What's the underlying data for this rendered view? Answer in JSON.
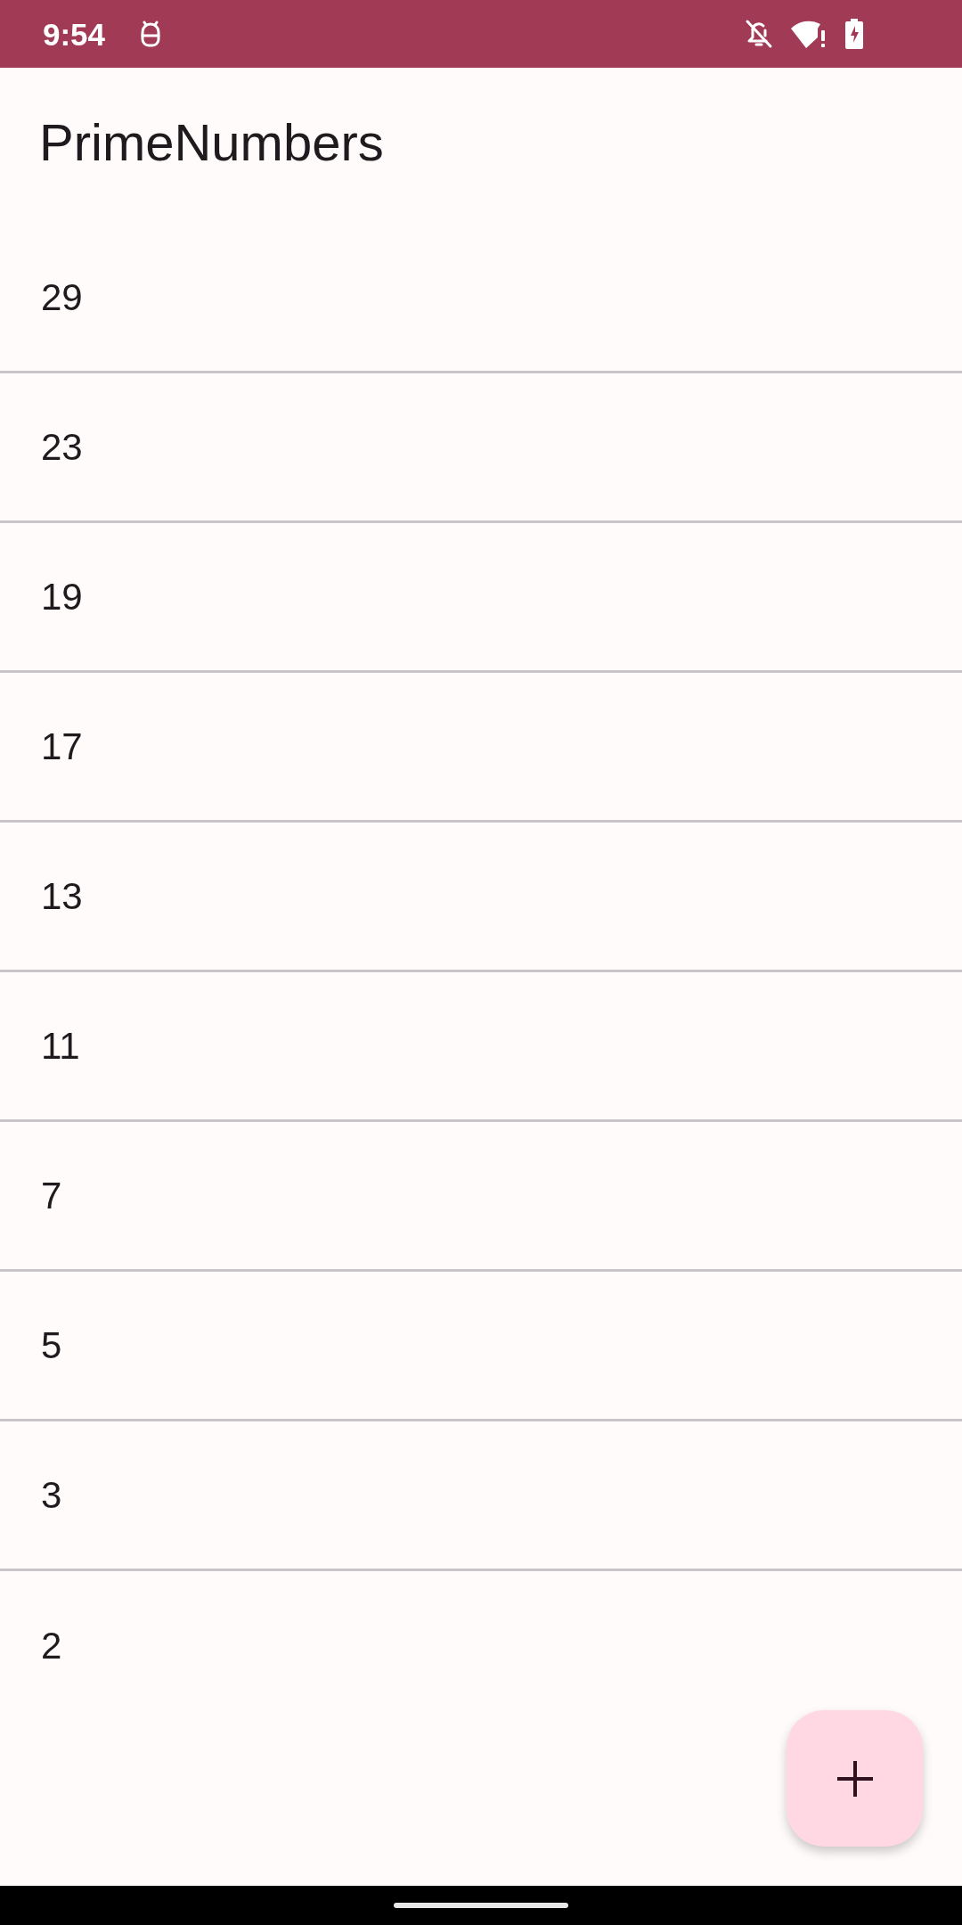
{
  "status_bar": {
    "time": "9:54"
  },
  "app_bar": {
    "title": "PrimeNumbers"
  },
  "list": {
    "items": [
      "29",
      "23",
      "19",
      "17",
      "13",
      "11",
      "7",
      "5",
      "3",
      "2"
    ]
  }
}
